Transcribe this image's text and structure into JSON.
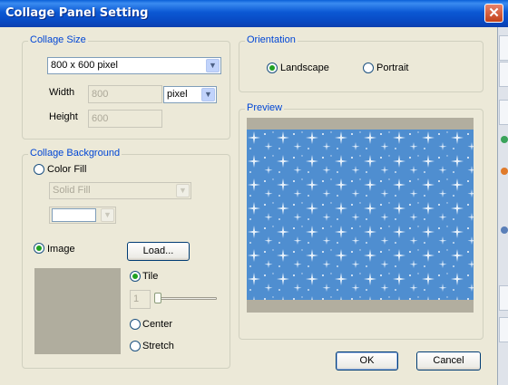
{
  "window": {
    "title": "Collage Panel Setting",
    "close_symbol": "✕"
  },
  "collage_size": {
    "legend": "Collage Size",
    "preset": "800 x 600 pixel",
    "width_label": "Width",
    "width_value": "800",
    "unit": "pixel",
    "height_label": "Height",
    "height_value": "600"
  },
  "collage_background": {
    "legend": "Collage Background",
    "color_fill_label": "Color Fill",
    "color_fill_checked": false,
    "fill_type": "Solid Fill",
    "fill_color": "#ffffff",
    "image_label": "Image",
    "image_checked": true,
    "load_button": "Load...",
    "tile_label": "Tile",
    "tile_checked": true,
    "tile_count": "1",
    "center_label": "Center",
    "stretch_label": "Stretch"
  },
  "orientation": {
    "legend": "Orientation",
    "landscape_label": "Landscape",
    "landscape_checked": true,
    "portrait_label": "Portrait"
  },
  "preview": {
    "legend": "Preview",
    "pattern_color": "#4f8ed0",
    "border_color": "#b2ae9f"
  },
  "buttons": {
    "ok": "OK",
    "cancel": "Cancel"
  },
  "colors": {
    "title_bar": "#0b58d4",
    "accent": "#0046d5",
    "radio_dot": "#21a121"
  }
}
